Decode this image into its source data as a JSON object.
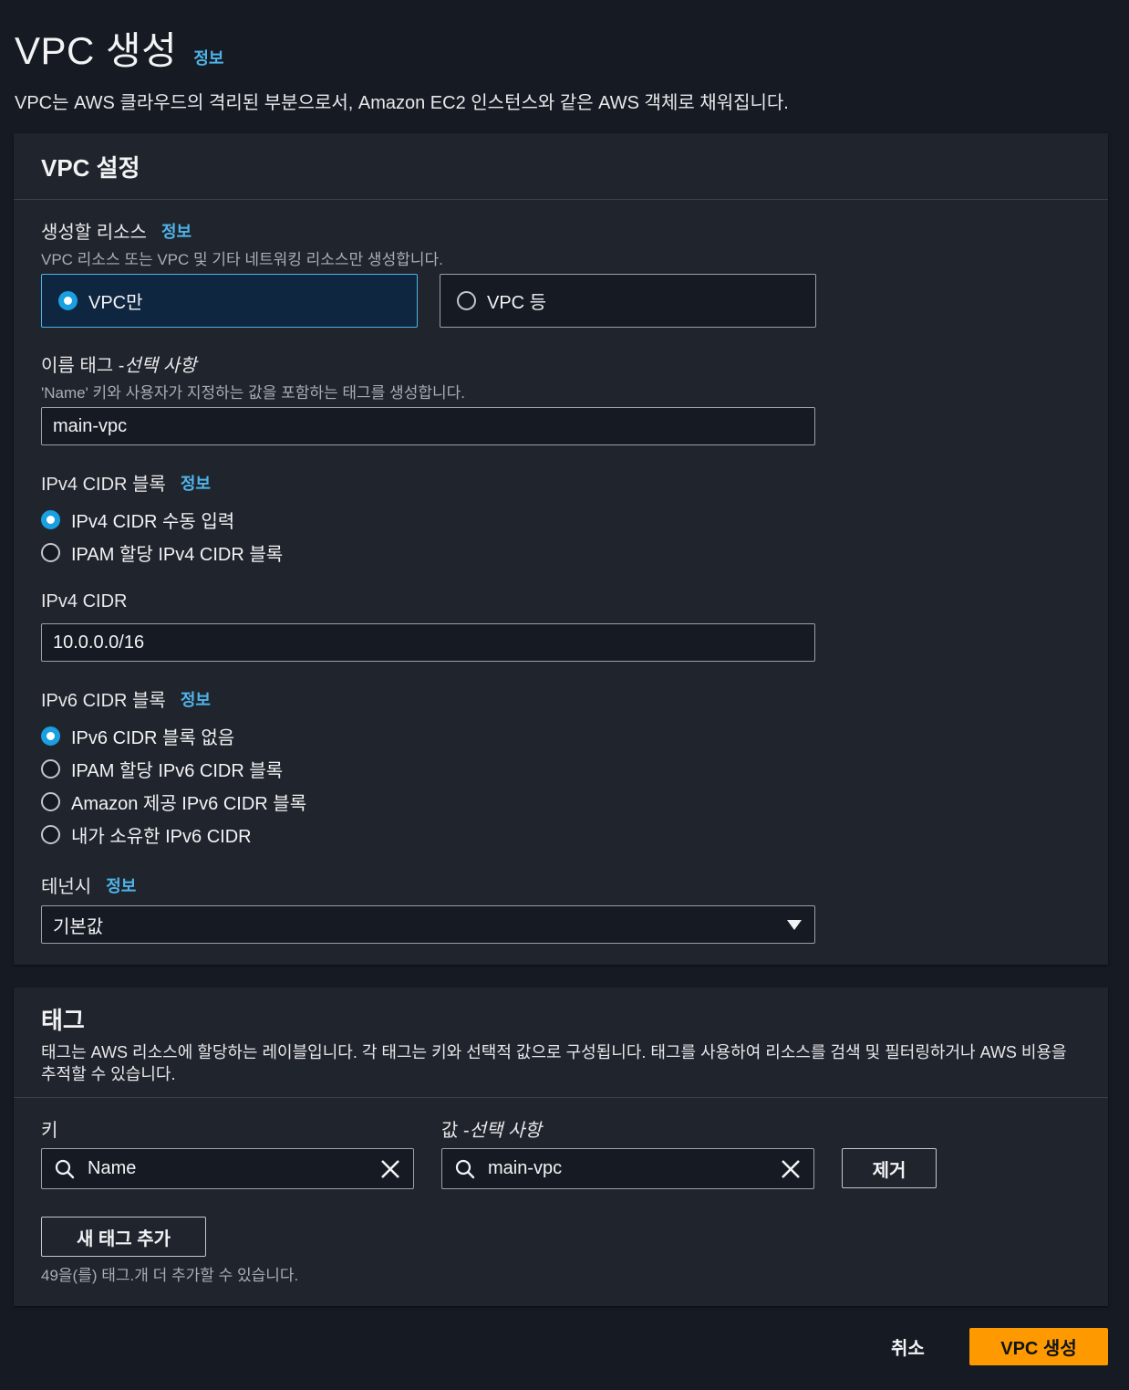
{
  "header": {
    "title": "VPC 생성",
    "info": "정보",
    "description": "VPC는 AWS 클라우드의 격리된 부분으로서, Amazon EC2 인스턴스와 같은 AWS 객체로 채워집니다."
  },
  "vpc_settings": {
    "title": "VPC 설정",
    "resources": {
      "label": "생성할 리소스",
      "info": "정보",
      "hint": "VPC 리소스 또는 VPC 및 기타 네트워킹 리소스만 생성합니다.",
      "options": [
        {
          "label": "VPC만",
          "selected": true
        },
        {
          "label": "VPC 등",
          "selected": false
        }
      ]
    },
    "name_tag": {
      "label": "이름 태그 - ",
      "optional": "선택 사항",
      "hint": "'Name' 키와 사용자가 지정하는 값을 포함하는 태그를 생성합니다.",
      "value": "main-vpc"
    },
    "ipv4_block": {
      "label": "IPv4 CIDR 블록",
      "info": "정보",
      "options": [
        {
          "label": "IPv4 CIDR 수동 입력",
          "selected": true
        },
        {
          "label": "IPAM 할당 IPv4 CIDR 블록",
          "selected": false
        }
      ]
    },
    "ipv4_cidr": {
      "label": "IPv4 CIDR",
      "value": "10.0.0.0/16"
    },
    "ipv6_block": {
      "label": "IPv6 CIDR 블록",
      "info": "정보",
      "options": [
        {
          "label": "IPv6 CIDR 블록 없음",
          "selected": true
        },
        {
          "label": "IPAM 할당 IPv6 CIDR 블록",
          "selected": false
        },
        {
          "label": "Amazon 제공 IPv6 CIDR 블록",
          "selected": false
        },
        {
          "label": "내가 소유한 IPv6 CIDR",
          "selected": false
        }
      ]
    },
    "tenancy": {
      "label": "테넌시",
      "info": "정보",
      "value": "기본값"
    }
  },
  "tags": {
    "title": "태그",
    "description": "태그는 AWS 리소스에 할당하는 레이블입니다. 각 태그는 키와 선택적 값으로 구성됩니다. 태그를 사용하여 리소스를 검색 및 필터링하거나 AWS 비용을 추적할 수 있습니다.",
    "key_label": "키",
    "value_label": "값 - ",
    "value_optional": "선택 사항",
    "key_value": "Name",
    "value_value": "main-vpc",
    "remove_button": "제거",
    "add_button": "새 태그 추가",
    "remaining": "49을(를) 태그.개 더 추가할 수 있습니다."
  },
  "footer": {
    "cancel": "취소",
    "submit": "VPC 생성"
  }
}
